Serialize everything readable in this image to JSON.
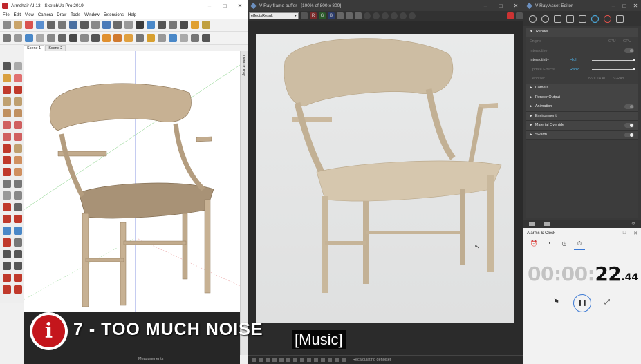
{
  "sketchup": {
    "title": "Armchair AI 13 - SketchUp Pro 2019",
    "window_controls": [
      "–",
      "□",
      "✕"
    ],
    "menu": [
      "File",
      "Edit",
      "View",
      "Camera",
      "Draw",
      "Tools",
      "Window",
      "Extensions",
      "Help"
    ],
    "scenes": [
      "Scene 1",
      "Scene 2"
    ],
    "tray_label": "Default Tray",
    "measurements_label": "Measurements"
  },
  "framebuffer": {
    "title": "V-Ray frame buffer - [100% of 800 x 800]",
    "window_controls": [
      "–",
      "□",
      "✕"
    ],
    "channel": "effectsResult",
    "channel_buttons": [
      "R",
      "G",
      "B"
    ],
    "status": "Recalculating denoiser"
  },
  "asset_editor": {
    "title": "V-Ray Asset Editor",
    "window_controls": [
      "–",
      "□",
      "✕"
    ],
    "render_section": "Render",
    "rows": {
      "engine_label": "Engine",
      "engine_cpu": "CPU",
      "engine_gpu": "GPU",
      "interactive_label": "Interactive",
      "interactivity_label": "Interactivity",
      "interactivity_value": "High",
      "update_effects_label": "Update Effects",
      "update_effects_value": "Rapid",
      "denoiser_label": "Denoiser",
      "denoiser_nvidia": "NVIDIA AI",
      "denoiser_vray": "V-RAY"
    },
    "sections": [
      "Camera",
      "Render Output",
      "Animation",
      "Environment",
      "Material Override",
      "Swarm"
    ]
  },
  "alarms": {
    "title": "Alarms & Clock",
    "window_controls": [
      "–",
      "□",
      "✕"
    ],
    "time_dim": "00:00:",
    "time_seconds": "22",
    "time_centis": ".44"
  },
  "overlay": {
    "episode_title": "7 - TOO MUCH NOISE",
    "caption": "[Music]"
  },
  "colors": {
    "accent_blue": "#4db2e8",
    "logo_red": "#c4161c",
    "clock_accent": "#3a78d4"
  }
}
